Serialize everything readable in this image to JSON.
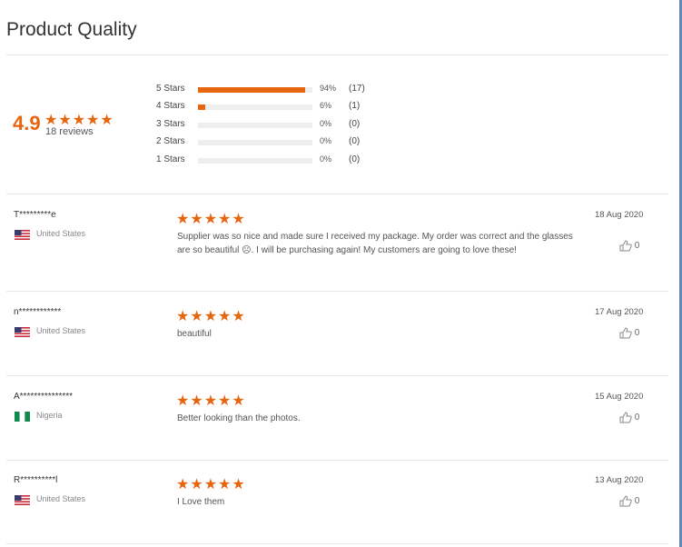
{
  "page": {
    "title": "Product Quality"
  },
  "summary": {
    "score": "4.9",
    "stars": "★★★★★",
    "review_count_text": "18 reviews"
  },
  "distribution": [
    {
      "label": "5 Stars",
      "percent": 94,
      "percent_text": "94%",
      "count_text": "(17)"
    },
    {
      "label": "4 Stars",
      "percent": 6,
      "percent_text": "6%",
      "count_text": "(1)"
    },
    {
      "label": "3 Stars",
      "percent": 0,
      "percent_text": "0%",
      "count_text": "(0)"
    },
    {
      "label": "2 Stars",
      "percent": 0,
      "percent_text": "0%",
      "count_text": "(0)"
    },
    {
      "label": "1 Stars",
      "percent": 0,
      "percent_text": "0%",
      "count_text": "(0)"
    }
  ],
  "reviews": [
    {
      "name": "T*********e",
      "country": "United States",
      "flag": "us-flag-icon",
      "stars": "★★★★★",
      "text": "Supplier was so nice and made sure I received my package. My order was correct and the glasses are so beautiful ☹. I will be purchasing again! My customers are going to love these!",
      "date": "18 Aug 2020",
      "likes": "0"
    },
    {
      "name": "n************",
      "country": "United States",
      "flag": "us-flag-icon",
      "stars": "★★★★★",
      "text": "beautiful",
      "date": "17 Aug 2020",
      "likes": "0"
    },
    {
      "name": "A***************",
      "country": "Nigeria",
      "flag": "ng-flag-icon",
      "stars": "★★★★★",
      "text": "Better looking than the photos.",
      "date": "15 Aug 2020",
      "likes": "0"
    },
    {
      "name": "R**********l",
      "country": "United States",
      "flag": "us-flag-icon",
      "stars": "★★★★★",
      "text": "I Love them",
      "date": "13 Aug 2020",
      "likes": "0"
    }
  ],
  "colors": {
    "accent": "#e8650f",
    "divider": "#e6e6e6"
  }
}
